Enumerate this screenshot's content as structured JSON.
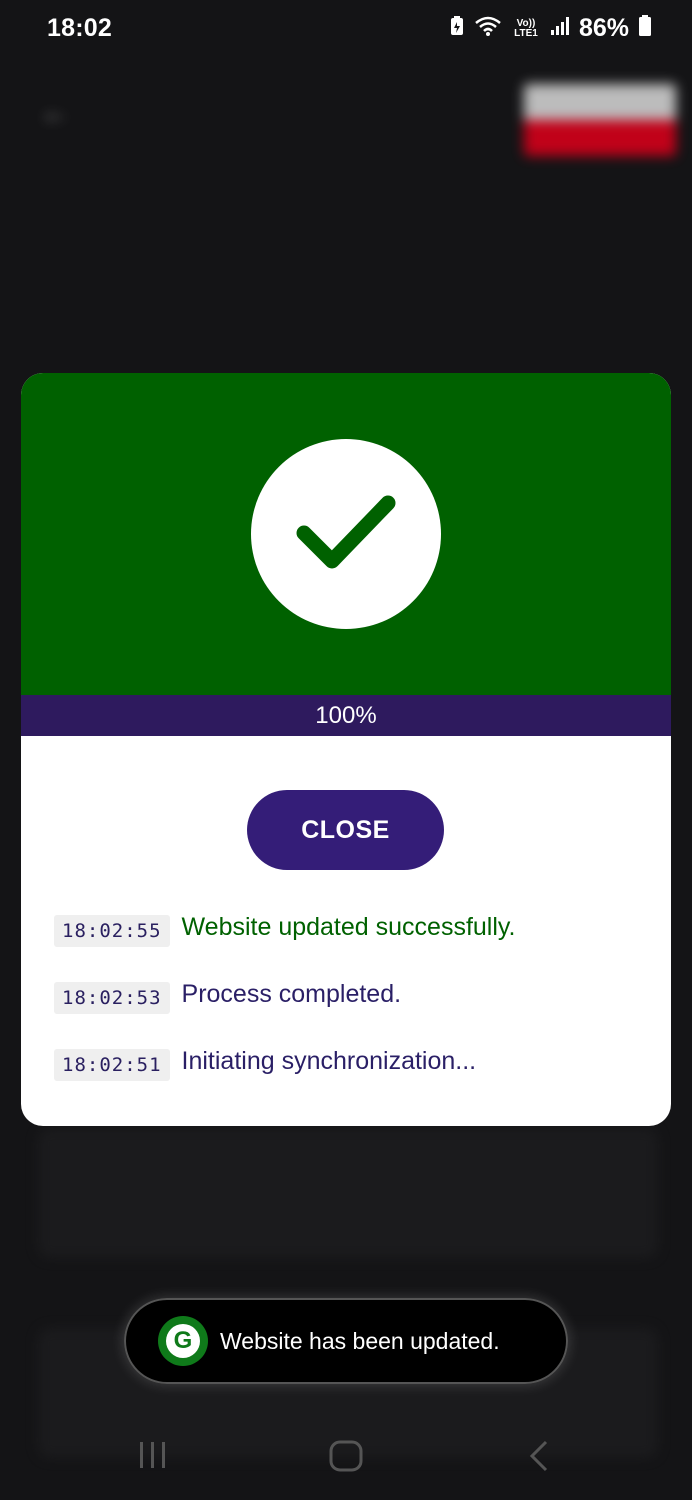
{
  "status_bar": {
    "time": "18:02",
    "battery_percent": "86%",
    "network_label": "Vo)) LTE1",
    "icons": [
      "battery-saver-icon",
      "wifi-icon",
      "volte-icon",
      "signal-icon",
      "battery-icon"
    ]
  },
  "dialog": {
    "progress": 1.0,
    "progress_text": "100%",
    "close_label": "CLOSE",
    "hero_color": "#006100",
    "progress_color": "#331a66",
    "logs": [
      {
        "time": "18:02:55",
        "message": "Website updated successfully.",
        "status": "success"
      },
      {
        "time": "18:02:53",
        "message": "Process completed.",
        "status": "info"
      },
      {
        "time": "18:02:51",
        "message": "Initiating synchronization...",
        "status": "info"
      }
    ]
  },
  "toast": {
    "app_icon_letter": "G",
    "message": "Website has been updated."
  },
  "nav": {
    "buttons": [
      "recent-apps-icon",
      "home-icon",
      "back-icon"
    ]
  },
  "colors": {
    "success_green": "#006100",
    "accent_purple": "#341d78",
    "text_purple": "#2a1f66"
  }
}
